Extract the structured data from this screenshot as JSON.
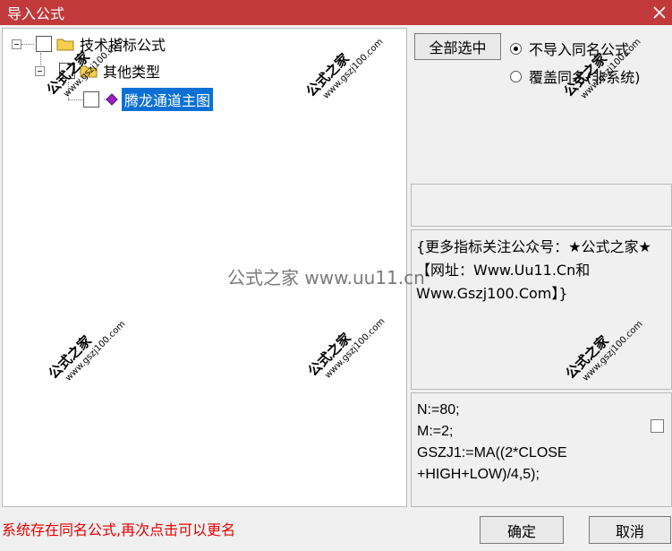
{
  "window": {
    "title": "导入公式"
  },
  "tree": {
    "root": {
      "label": "技术指标公式"
    },
    "child": {
      "label": "其他类型"
    },
    "leaf": {
      "label": "腾龙通道主图"
    }
  },
  "buttons": {
    "select_all": "全部选中",
    "ok": "确定",
    "cancel": "取消"
  },
  "options": {
    "no_import_same": "不导入同名公式",
    "overwrite_same": "覆盖同名(非系统)",
    "selected": "no_import_same"
  },
  "description": "{更多指标关注公众号：★公式之家★ 【网址：Www.Uu11.Cn和Www.Gszj100.Com】}",
  "formula": {
    "lines": [
      "N:=80;",
      "M:=2;",
      "GSZJ1:=MA((2*CLOSE",
      "+HIGH+LOW)/4,5);"
    ]
  },
  "status": {
    "message": "系统存在同名公式,再次点击可以更名"
  },
  "watermarks": {
    "main": "公式之家",
    "sub": "www.gszj100.com",
    "center": "公式之家 www.uu11.cn"
  },
  "colors": {
    "titlebar": "#c1393b",
    "selection": "#0a70d6",
    "status_text": "#e60000"
  }
}
